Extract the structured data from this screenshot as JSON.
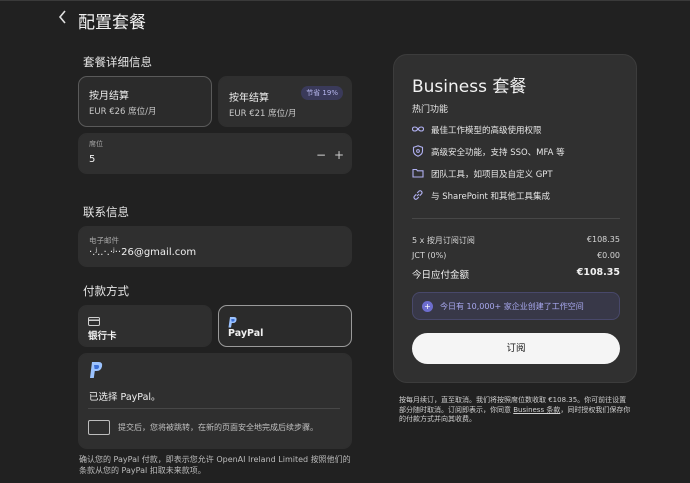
{
  "header": {
    "back_icon": "chevron-left-icon",
    "title": "配置套餐"
  },
  "plan_details": {
    "heading": "套餐详细信息",
    "monthly": {
      "title": "按月结算",
      "price": "EUR €26 席位/月"
    },
    "yearly": {
      "title": "按年结算",
      "price": "EUR €21 席位/月",
      "badge": "节省 19%"
    },
    "seats": {
      "label": "席位",
      "value": "5",
      "minus": "−",
      "plus": "+"
    }
  },
  "contact": {
    "heading": "联系信息",
    "email_label": "电子邮件",
    "email_value": "·.ʲ..·.·ʲ··26@gmail.com"
  },
  "payment": {
    "heading": "付款方式",
    "card_label": "银行卡",
    "paypal_label": "PayPal",
    "selected_text": "已选择 PayPal。",
    "redirect_text": "提交后，您将被跳转，在新的页面安全地完成后续步骤。",
    "consent": "确认您的 PayPal 付款，即表示您允许 OpenAI Ireland Limited 按照他们的条款从您的 PayPal 扣取未来款项。"
  },
  "summary": {
    "title": "Business 套餐",
    "hot_label": "热门功能",
    "features": [
      {
        "icon": "infinity-icon",
        "text": "最佳工作模型的高级使用权限"
      },
      {
        "icon": "shield-icon",
        "text": "高级安全功能，支持 SSO、MFA 等"
      },
      {
        "icon": "folder-icon",
        "text": "团队工具，如项目及自定义 GPT"
      },
      {
        "icon": "link-icon",
        "text": "与 SharePoint 和其他工具集成"
      }
    ],
    "lines": [
      {
        "label": "5 x 按月订阅订阅",
        "amount": "€108.35"
      },
      {
        "label": "JCT (0%)",
        "amount": "€0.00"
      }
    ],
    "total": {
      "label": "今日应付金额",
      "amount": "€108.35"
    },
    "info": "今日有 10,000+ 家企业创建了工作空间",
    "subscribe": "订阅",
    "fine_print_a": "按每月续订，直至取消。我们将按照席位数收取 €108.35。你可前往设置部分随时取消。订阅即表示，你同意 ",
    "fine_print_link": "Business 条款",
    "fine_print_b": "，同时授权我们保存你的付款方式并向其收费。"
  },
  "colors": {
    "background": "#212121",
    "card": "#2f2f2f",
    "accent": "#6d6dce"
  }
}
